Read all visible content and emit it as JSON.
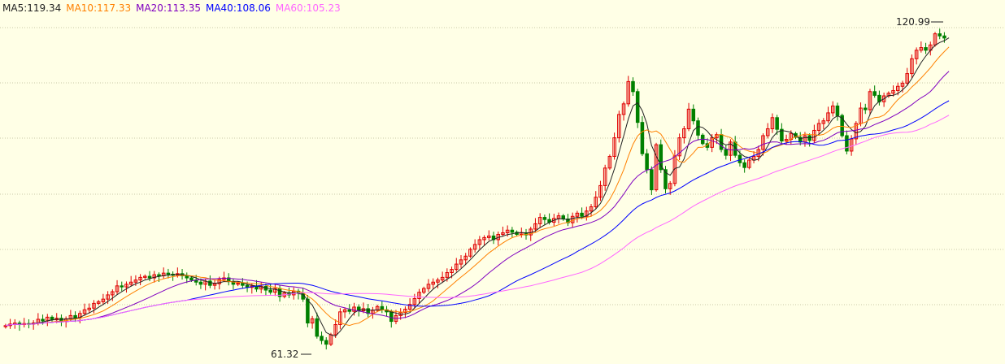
{
  "legend": [
    {
      "label": "MA5:119.34",
      "color": "#222222"
    },
    {
      "label": "MA10:117.33",
      "color": "#ff8000"
    },
    {
      "label": "MA20:113.35",
      "color": "#8000c0"
    },
    {
      "label": "MA40:108.06",
      "color": "#0000ff"
    },
    {
      "label": "MA60:105.23",
      "color": "#ff66ff"
    }
  ],
  "colors": {
    "background": "#ffffe6",
    "grid": "#c8c8a8",
    "up": "#e00000",
    "down": "#008000"
  },
  "chart_data": {
    "type": "candlestick",
    "ylim": [
      60,
      124
    ],
    "grid": "horizontal dotted",
    "max_label": "120.99",
    "min_label": "61.32",
    "series_names": [
      "MA5",
      "MA10",
      "MA20",
      "MA40",
      "MA60"
    ],
    "close": [
      66.0,
      66.3,
      66.5,
      66.2,
      66.4,
      66.3,
      66.5,
      67.2,
      66.9,
      67.6,
      67.1,
      67.4,
      66.8,
      67.3,
      67.9,
      67.5,
      68.3,
      69.0,
      69.3,
      70.2,
      70.5,
      71.0,
      71.8,
      72.4,
      73.5,
      73.3,
      73.8,
      74.2,
      74.6,
      75.1,
      75.3,
      75.0,
      75.6,
      75.4,
      75.9,
      75.7,
      75.5,
      75.8,
      75.4,
      75.0,
      74.6,
      74.2,
      73.8,
      74.4,
      73.6,
      73.9,
      74.7,
      75.0,
      74.3,
      73.8,
      74.0,
      73.6,
      73.2,
      73.5,
      72.9,
      73.4,
      72.7,
      72.3,
      73.0,
      71.5,
      72.2,
      71.8,
      72.5,
      72.1,
      71.0,
      66.5,
      67.3,
      64.0,
      63.2,
      62.5,
      64.3,
      66.2,
      68.6,
      69.0,
      68.7,
      69.5,
      68.8,
      69.2,
      68.3,
      68.9,
      69.6,
      69.0,
      68.6,
      66.8,
      67.9,
      68.5,
      69.1,
      70.0,
      71.1,
      72.3,
      73.0,
      73.8,
      74.2,
      74.6,
      75.1,
      76.0,
      76.6,
      77.6,
      78.4,
      79.1,
      80.4,
      81.3,
      82.2,
      82.6,
      82.9,
      82.2,
      83.2,
      83.5,
      84.0,
      83.6,
      83.2,
      83.5,
      83.1,
      84.2,
      85.2,
      86.4,
      86.0,
      85.5,
      86.2,
      86.7,
      86.1,
      85.4,
      86.6,
      87.2,
      86.6,
      87.6,
      88.4,
      90.2,
      92.4,
      95.7,
      97.9,
      101.4,
      105.8,
      107.8,
      112.0,
      110.1,
      104.3,
      98.4,
      95.4,
      91.6,
      100.1,
      95.4,
      91.8,
      92.8,
      98.0,
      101.4,
      103.1,
      106.8,
      104.6,
      101.9,
      100.3,
      99.6,
      101.4,
      102.0,
      99.2,
      98.1,
      100.6,
      98.1,
      96.7,
      95.8,
      97.2,
      97.9,
      99.2,
      101.8,
      103.1,
      105.2,
      103.0,
      100.8,
      101.1,
      102.2,
      101.5,
      100.6,
      101.8,
      100.9,
      102.8,
      104.1,
      104.6,
      106.1,
      107.4,
      105.6,
      101.8,
      98.9,
      101.2,
      104.1,
      107.0,
      106.7,
      110.1,
      109.4,
      108.2,
      109.3,
      109.8,
      110.3,
      111.1,
      111.7,
      113.5,
      116.3,
      117.9,
      118.4,
      117.9,
      118.9,
      121.0,
      120.6,
      120.2,
      120.5
    ],
    "open": [
      65.8,
      66.0,
      66.3,
      66.5,
      66.2,
      66.4,
      66.3,
      66.5,
      67.2,
      66.9,
      67.6,
      67.1,
      67.4,
      66.8,
      67.3,
      67.9,
      67.5,
      68.3,
      69.0,
      69.3,
      70.2,
      70.5,
      71.0,
      71.8,
      72.4,
      73.5,
      73.3,
      73.8,
      74.2,
      74.6,
      75.1,
      75.3,
      75.0,
      75.6,
      75.4,
      75.9,
      75.7,
      75.5,
      75.8,
      75.4,
      75.0,
      74.6,
      74.2,
      73.8,
      74.4,
      73.6,
      73.9,
      74.7,
      75.0,
      74.3,
      73.8,
      74.0,
      73.6,
      73.2,
      73.5,
      72.9,
      73.4,
      72.7,
      72.3,
      73.0,
      71.5,
      72.2,
      71.8,
      72.5,
      72.1,
      71.0,
      66.5,
      67.3,
      64.0,
      63.2,
      62.5,
      64.3,
      66.2,
      68.6,
      69.0,
      68.7,
      69.5,
      68.8,
      69.2,
      68.3,
      68.9,
      69.6,
      69.0,
      68.6,
      66.8,
      67.9,
      68.5,
      69.1,
      70.0,
      71.1,
      72.3,
      73.0,
      73.8,
      74.2,
      74.6,
      75.1,
      76.0,
      76.6,
      77.6,
      78.4,
      79.1,
      80.4,
      81.3,
      82.2,
      82.6,
      82.9,
      82.2,
      83.2,
      83.5,
      84.0,
      83.6,
      83.2,
      83.5,
      83.1,
      84.2,
      85.2,
      86.4,
      86.0,
      85.5,
      86.2,
      86.7,
      86.1,
      85.4,
      86.6,
      87.2,
      86.6,
      87.6,
      88.4,
      90.2,
      92.4,
      95.7,
      97.9,
      101.4,
      105.8,
      107.8,
      112.0,
      110.1,
      104.3,
      98.4,
      95.4,
      91.6,
      100.1,
      95.4,
      91.8,
      92.8,
      98.0,
      101.4,
      103.1,
      106.8,
      104.6,
      101.9,
      100.3,
      99.6,
      101.4,
      102.0,
      99.2,
      98.1,
      100.6,
      98.1,
      96.7,
      95.8,
      97.2,
      97.9,
      99.2,
      101.8,
      103.1,
      105.2,
      103.0,
      100.8,
      101.1,
      102.2,
      101.5,
      100.6,
      101.8,
      100.9,
      102.8,
      104.1,
      104.6,
      106.1,
      107.4,
      105.6,
      101.8,
      98.9,
      101.2,
      104.1,
      107.0,
      106.7,
      110.1,
      109.4,
      108.2,
      109.3,
      109.8,
      110.3,
      111.1,
      111.7,
      113.5,
      116.3,
      117.9,
      118.4,
      117.9,
      118.9,
      121.0,
      120.6
    ]
  }
}
